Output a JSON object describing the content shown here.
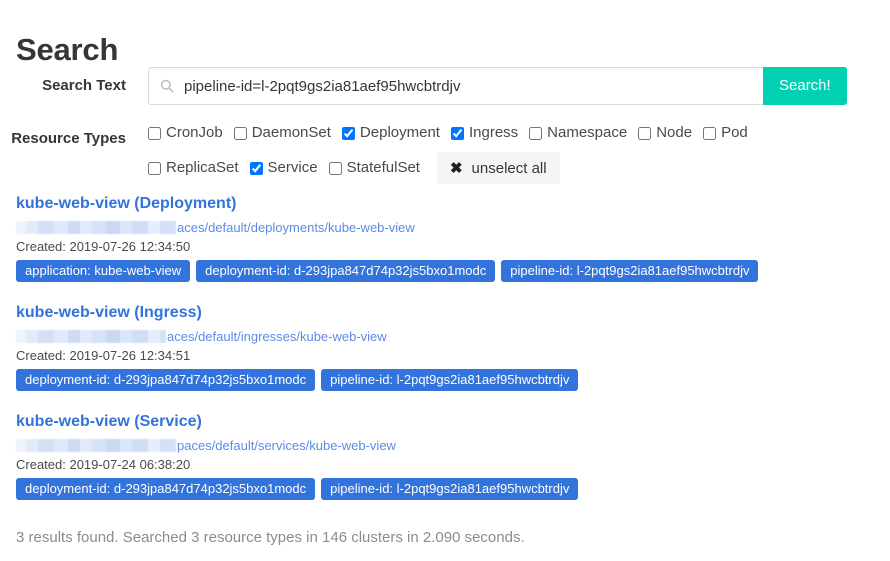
{
  "page": {
    "title": "Search"
  },
  "form": {
    "search_label": "Search Text",
    "search_value": "pipeline-id=l-2pqt9gs2ia81aef95hwcbtrdjv",
    "search_placeholder": "Search",
    "search_icon": "search-icon",
    "search_button_label": "Search!",
    "resource_types_label": "Resource Types",
    "unselect_all_label": "unselect all",
    "unselect_all_icon": "close-x-icon",
    "resource_types_row1": [
      {
        "label": "CronJob",
        "checked": false
      },
      {
        "label": "DaemonSet",
        "checked": false
      },
      {
        "label": "Deployment",
        "checked": true
      },
      {
        "label": "Ingress",
        "checked": true
      },
      {
        "label": "Namespace",
        "checked": false
      },
      {
        "label": "Node",
        "checked": false
      },
      {
        "label": "Pod",
        "checked": false
      }
    ],
    "resource_types_row2": [
      {
        "label": "ReplicaSet",
        "checked": false
      },
      {
        "label": "Service",
        "checked": true
      },
      {
        "label": "StatefulSet",
        "checked": false
      }
    ]
  },
  "results": [
    {
      "title": "kube-web-view (Deployment)",
      "url_redacted": true,
      "url_visible": "aces/default/deployments/kube-web-view",
      "created_label": "Created: 2019-07-26 12:34:50",
      "tags": [
        "application: kube-web-view",
        "deployment-id: d-293jpa847d74p32js5bxo1modc",
        "pipeline-id: l-2pqt9gs2ia81aef95hwcbtrdjv"
      ]
    },
    {
      "title": "kube-web-view (Ingress)",
      "url_redacted": true,
      "url_visible": "aces/default/ingresses/kube-web-view",
      "created_label": "Created: 2019-07-26 12:34:51",
      "tags": [
        "deployment-id: d-293jpa847d74p32js5bxo1modc",
        "pipeline-id: l-2pqt9gs2ia81aef95hwcbtrdjv"
      ]
    },
    {
      "title": "kube-web-view (Service)",
      "url_redacted": true,
      "url_visible": "paces/default/services/kube-web-view",
      "created_label": "Created: 2019-07-24 06:38:20",
      "tags": [
        "deployment-id: d-293jpa847d74p32js5bxo1modc",
        "pipeline-id: l-2pqt9gs2ia81aef95hwcbtrdjv"
      ]
    }
  ],
  "footer": {
    "status": "3 results found. Searched 3 resource types in 146 clusters in 2.090 seconds."
  },
  "colors": {
    "primary": "#00d1b2",
    "link": "#3273dc",
    "title": "#363636",
    "muted": "#8c8c8c",
    "button_bg": "#f5f5f5"
  }
}
